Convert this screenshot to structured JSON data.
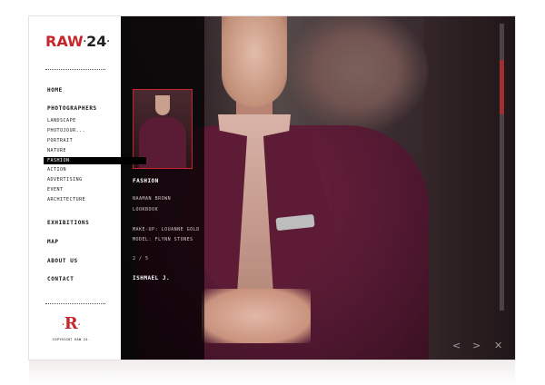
{
  "logo": {
    "brand": "RAW",
    "number": "24",
    "dot": "·"
  },
  "nav": {
    "home": "HOME",
    "photographers": "PHOTOGRAPHERS",
    "categories": [
      "LANDSCAPE",
      "PHOTOJOUR...",
      "PORTRAIT",
      "NATURE",
      "FASHION",
      "ACTION",
      "ADVERTISING",
      "EVENT",
      "ARCHITECTURE"
    ],
    "active_category": "FASHION",
    "exhibitions": "EXHIBITIONS",
    "map": "MAP",
    "about": "ABOUT US",
    "contact": "CONTACT"
  },
  "footer": {
    "mark": "R",
    "copyright": "COPYRIGHT RAW 24."
  },
  "photo_info": {
    "category": "FASHION",
    "credit_1": "NAAMAN BROWN",
    "credit_2": "LOOKBOOK",
    "makeup": "MAKE-UP: LOUANNE GOLD",
    "model": "MODEL: FLYNN STONES",
    "counter": "2 / 5",
    "photographer": "ISHMAEL J."
  },
  "controls": {
    "prev": "<",
    "next": ">",
    "close": "✕"
  },
  "colors": {
    "accent": "#c6252b",
    "sidebar_bg": "#ffffff",
    "overlay": "#000000"
  }
}
